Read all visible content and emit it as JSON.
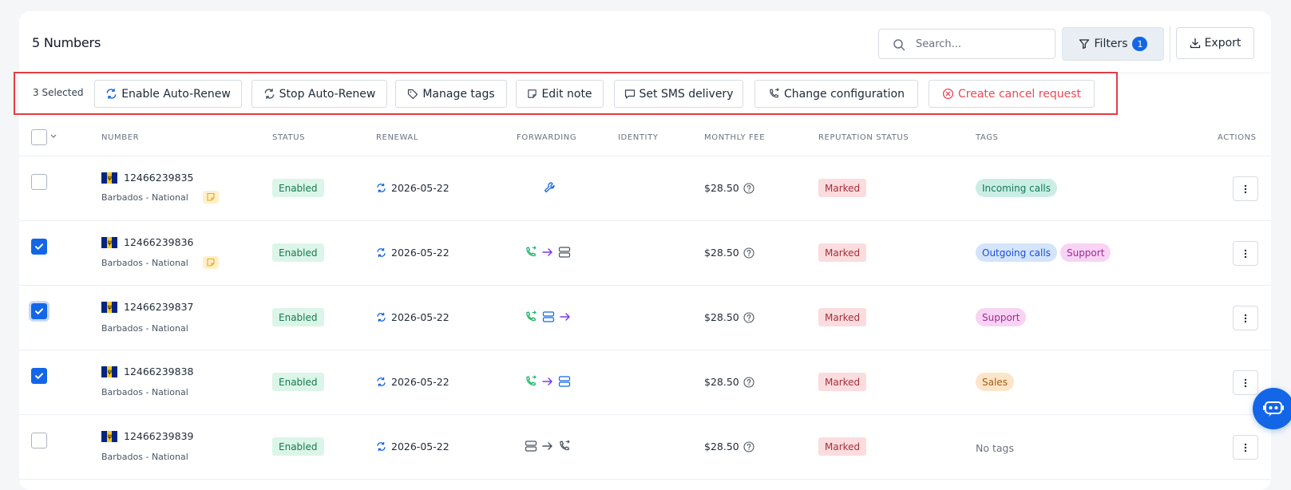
{
  "header": {
    "title": "5 Numbers",
    "search_placeholder": "Search...",
    "filters_label": "Filters",
    "filters_count": "1",
    "export_label": "Export"
  },
  "bulk": {
    "selected_label": "3 Selected",
    "enable_auto_renew": "Enable Auto-Renew",
    "stop_auto_renew": "Stop Auto-Renew",
    "manage_tags": "Manage tags",
    "edit_note": "Edit note",
    "set_sms_delivery": "Set SMS delivery",
    "change_configuration": "Change configuration",
    "create_cancel_request": "Create cancel request"
  },
  "columns": {
    "number": "NUMBER",
    "status": "STATUS",
    "renewal": "RENEWAL",
    "forwarding": "FORWARDING",
    "identity": "IDENTITY",
    "monthly_fee": "MONTHLY FEE",
    "reputation_status": "REPUTATION STATUS",
    "tags": "TAGS",
    "actions": "ACTIONS"
  },
  "rows": [
    {
      "number": "12466239835",
      "country": "Barbados - National",
      "status": "Enabled",
      "renewal": "2026-05-22",
      "fee": "$28.50",
      "reputation": "Marked",
      "tags": [
        "Incoming calls"
      ],
      "selected": false
    },
    {
      "number": "12466239836",
      "country": "Barbados - National",
      "status": "Enabled",
      "renewal": "2026-05-22",
      "fee": "$28.50",
      "reputation": "Marked",
      "tags": [
        "Outgoing calls",
        "Support"
      ],
      "selected": true
    },
    {
      "number": "12466239837",
      "country": "Barbados - National",
      "status": "Enabled",
      "renewal": "2026-05-22",
      "fee": "$28.50",
      "reputation": "Marked",
      "tags": [
        "Support"
      ],
      "selected": true
    },
    {
      "number": "12466239838",
      "country": "Barbados - National",
      "status": "Enabled",
      "renewal": "2026-05-22",
      "fee": "$28.50",
      "reputation": "Marked",
      "tags": [
        "Sales"
      ],
      "selected": true
    },
    {
      "number": "12466239839",
      "country": "Barbados - National",
      "status": "Enabled",
      "renewal": "2026-05-22",
      "fee": "$28.50",
      "reputation": "Marked",
      "tags": [],
      "no_tags_label": "No tags",
      "selected": false
    }
  ],
  "colors": {
    "accent": "#1366e6",
    "danger": "#e8495a",
    "highlight_border": "#e23d43"
  }
}
